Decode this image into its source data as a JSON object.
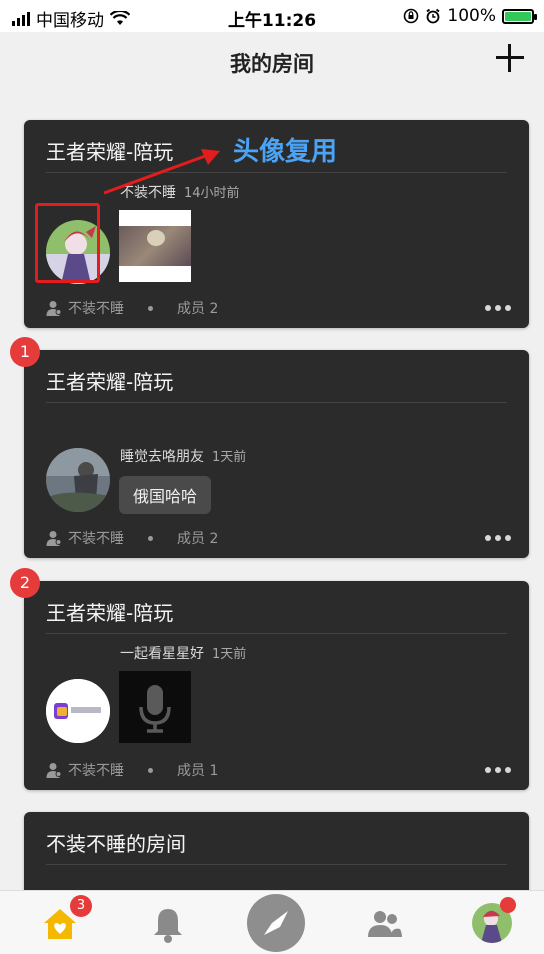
{
  "status_bar": {
    "carrier": "中国移动",
    "time": "上午11:26",
    "battery": "100%",
    "battery_level": 1.0
  },
  "nav": {
    "title": "我的房间"
  },
  "annotation": {
    "label": "头像复用"
  },
  "rooms": [
    {
      "title": "王者荣耀-陪玩",
      "sender": "不装不睡",
      "time": "14小时前",
      "owner": "不装不睡",
      "members": "成员 2"
    },
    {
      "badge": "1",
      "title": "王者荣耀-陪玩",
      "sender": "睡觉去咯朋友",
      "time": "1天前",
      "message": "俄国哈哈",
      "owner": "不装不睡",
      "members": "成员 2"
    },
    {
      "badge": "2",
      "title": "王者荣耀-陪玩",
      "sender": "一起看星星好",
      "time": "1天前",
      "owner": "不装不睡",
      "members": "成员 1"
    },
    {
      "title": "不装不睡的房间"
    }
  ],
  "tab_bar": {
    "home_badge": "3",
    "items": [
      "home-icon",
      "bell-icon",
      "compass-icon",
      "friends-icon",
      "profile-avatar"
    ]
  }
}
